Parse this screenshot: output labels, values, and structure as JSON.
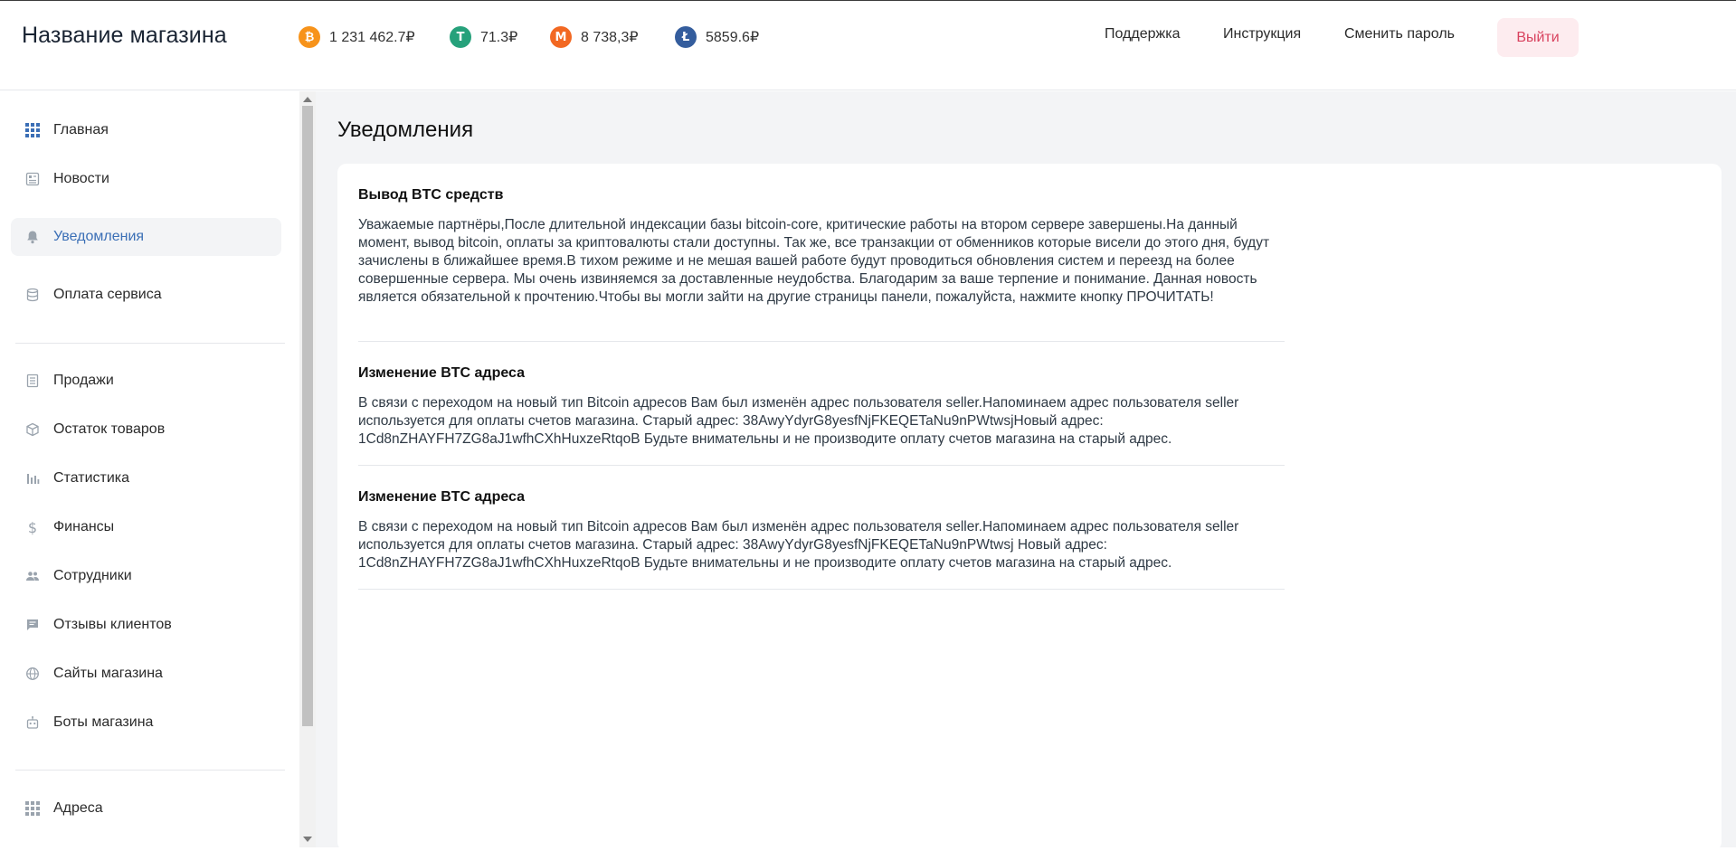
{
  "header": {
    "store_name": "Название магазина",
    "balances": [
      {
        "icon": "bitcoin-icon",
        "symbol": "₿",
        "color": "#f7931a",
        "value": "1 231 462.7₽"
      },
      {
        "icon": "tether-icon",
        "symbol": "T",
        "color": "#26a17b",
        "value": "71.3₽"
      },
      {
        "icon": "monero-icon",
        "symbol": "M",
        "color": "#f26822",
        "value": "8 738,3₽"
      },
      {
        "icon": "litecoin-icon",
        "symbol": "Ł",
        "color": "#345d9d",
        "value": "5859.6₽"
      }
    ],
    "nav": {
      "support": "Поддержка",
      "instructions": "Инструкция",
      "change_password": "Сменить пароль",
      "logout": "Выйти"
    }
  },
  "sidebar": {
    "items": [
      {
        "label": "Главная",
        "icon": "grid-icon"
      },
      {
        "label": "Новости",
        "icon": "news-icon"
      },
      {
        "label": "Уведомления",
        "icon": "bell-icon",
        "active": true
      },
      {
        "label": "Оплата сервиса",
        "icon": "database-icon"
      },
      {
        "label": "Продажи",
        "icon": "list-icon"
      },
      {
        "label": "Остаток товаров",
        "icon": "box-icon"
      },
      {
        "label": "Статистика",
        "icon": "bar-chart-icon"
      },
      {
        "label": "Финансы",
        "icon": "dollar-icon"
      },
      {
        "label": "Сотрудники",
        "icon": "users-icon"
      },
      {
        "label": "Отзывы клиентов",
        "icon": "chat-icon"
      },
      {
        "label": "Сайты магазина",
        "icon": "globe-icon"
      },
      {
        "label": "Боты магазина",
        "icon": "bot-icon"
      },
      {
        "label": "Адреса",
        "icon": "grid-icon"
      }
    ]
  },
  "main": {
    "title": "Уведомления",
    "notifications": [
      {
        "title": "Вывод BTC средств",
        "text": "Уважаемые партнёры,После длительной индексации базы bitcoin-core, критические работы на втором сервере завершены.На данный момент, вывод bitcoin, оплаты за криптовалюты стали доступны. Так же, все транзакции от обменников которые висели до этого дня, будут зачислены в ближайшее время.В тихом режиме и не мешая вашей работе будут проводиться обновления систем и переезд на более совершенные сервера. Мы очень извиняемся за доставленные неудобства. Благодарим за ваше терпение и понимание. Данная новость является обязательной к прочтению.Чтобы вы могли зайти на другие страницы панели, пожалуйста, нажмите кнопку ПРОЧИТАТЬ!"
      },
      {
        "title": "Изменение BTC адреса",
        "text": "В связи с переходом на новый тип Bitcoin адресов Вам был изменён адрес пользователя seller.Напоминаем адрес пользователя seller используется для оплаты счетов магазина. Старый адрес: 38AwyYdyrG8yesfNjFKEQETaNu9nPWtwsjНовый адрес: 1Cd8nZHAYFH7ZG8aJ1wfhCXhHuxzeRtqoB Будьте внимательны и не производите оплату счетов магазина на старый адрес."
      },
      {
        "title": "Изменение BTC адреса",
        "text": "В связи с переходом на новый тип Bitcoin адресов Вам был изменён адрес пользователя seller.Напоминаем адрес пользователя seller используется для оплаты счетов магазина. Старый адрес: 38AwyYdyrG8yesfNjFKEQETaNu9nPWtwsj Новый адрес: 1Cd8nZHAYFH7ZG8aJ1wfhCXhHuxzeRtqoB Будьте внимательны и не производите оплату счетов магазина на старый адрес."
      }
    ]
  },
  "colors": {
    "accent": "#3b6fb6",
    "logout_bg": "#fdecef",
    "logout_text": "#d9435f",
    "page_bg": "#f3f4f6"
  }
}
